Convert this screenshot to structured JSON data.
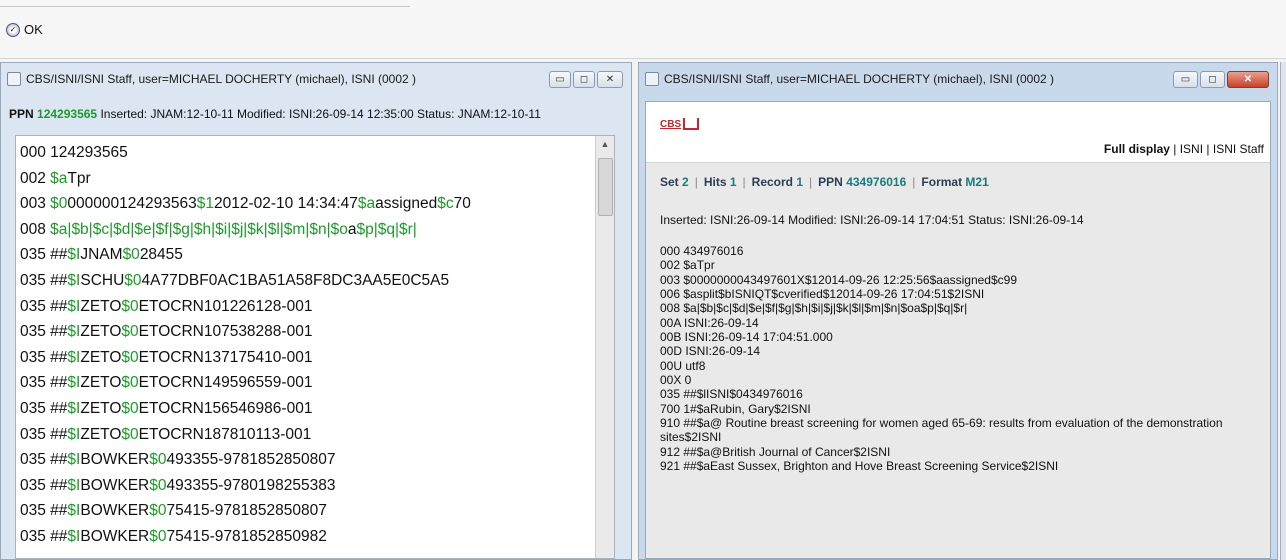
{
  "toolbar": {
    "ok_label": "OK"
  },
  "window_left": {
    "title": "CBS/ISNI/ISNI Staff, user=MICHAEL DOCHERTY (michael), ISNI (0002 )",
    "ppn_label": "PPN",
    "ppn_value": "124293565",
    "ppn_info": " Inserted: JNAM:12-10-11 Modified: ISNI:26-09-14 12:35:00 Status: JNAM:12-10-11",
    "records": [
      [
        {
          "t": "000 124293565",
          "c": "k"
        }
      ],
      [
        {
          "t": "002 ",
          "c": "k"
        },
        {
          "t": "$a",
          "c": "g"
        },
        {
          "t": "Tpr",
          "c": "k"
        }
      ],
      [
        {
          "t": "003 ",
          "c": "k"
        },
        {
          "t": "$0",
          "c": "g"
        },
        {
          "t": "000000124293563",
          "c": "k"
        },
        {
          "t": "$1",
          "c": "g"
        },
        {
          "t": "2012-02-10 14:34:47",
          "c": "k"
        },
        {
          "t": "$a",
          "c": "g"
        },
        {
          "t": "assigned",
          "c": "k"
        },
        {
          "t": "$c",
          "c": "g"
        },
        {
          "t": "70",
          "c": "k"
        }
      ],
      [
        {
          "t": "008 ",
          "c": "k"
        },
        {
          "t": "$a|$b|$c|$d|$e|$f|$g|$h|$i|$j|$k|$l|$m|$n|$o",
          "c": "g"
        },
        {
          "t": "a",
          "c": "k"
        },
        {
          "t": "$p|$q|$r|",
          "c": "g"
        }
      ],
      [
        {
          "t": "035 ##",
          "c": "k"
        },
        {
          "t": "$I",
          "c": "g"
        },
        {
          "t": "JNAM",
          "c": "k"
        },
        {
          "t": "$0",
          "c": "g"
        },
        {
          "t": "28455",
          "c": "k"
        }
      ],
      [
        {
          "t": "035 ##",
          "c": "k"
        },
        {
          "t": "$I",
          "c": "g"
        },
        {
          "t": "SCHU",
          "c": "k"
        },
        {
          "t": "$0",
          "c": "g"
        },
        {
          "t": "4A77DBF0AC1BA51A58F8DC3AA5E0C5A5",
          "c": "k"
        }
      ],
      [
        {
          "t": "035 ##",
          "c": "k"
        },
        {
          "t": "$I",
          "c": "g"
        },
        {
          "t": "ZETO",
          "c": "k"
        },
        {
          "t": "$0",
          "c": "g"
        },
        {
          "t": "ETOCRN101226128-001",
          "c": "k"
        }
      ],
      [
        {
          "t": "035 ##",
          "c": "k"
        },
        {
          "t": "$I",
          "c": "g"
        },
        {
          "t": "ZETO",
          "c": "k"
        },
        {
          "t": "$0",
          "c": "g"
        },
        {
          "t": "ETOCRN107538288-001",
          "c": "k"
        }
      ],
      [
        {
          "t": "035 ##",
          "c": "k"
        },
        {
          "t": "$I",
          "c": "g"
        },
        {
          "t": "ZETO",
          "c": "k"
        },
        {
          "t": "$0",
          "c": "g"
        },
        {
          "t": "ETOCRN137175410-001",
          "c": "k"
        }
      ],
      [
        {
          "t": "035 ##",
          "c": "k"
        },
        {
          "t": "$I",
          "c": "g"
        },
        {
          "t": "ZETO",
          "c": "k"
        },
        {
          "t": "$0",
          "c": "g"
        },
        {
          "t": "ETOCRN149596559-001",
          "c": "k"
        }
      ],
      [
        {
          "t": "035 ##",
          "c": "k"
        },
        {
          "t": "$I",
          "c": "g"
        },
        {
          "t": "ZETO",
          "c": "k"
        },
        {
          "t": "$0",
          "c": "g"
        },
        {
          "t": "ETOCRN156546986-001",
          "c": "k"
        }
      ],
      [
        {
          "t": "035 ##",
          "c": "k"
        },
        {
          "t": "$I",
          "c": "g"
        },
        {
          "t": "ZETO",
          "c": "k"
        },
        {
          "t": "$0",
          "c": "g"
        },
        {
          "t": "ETOCRN187810113-001",
          "c": "k"
        }
      ],
      [
        {
          "t": "035 ##",
          "c": "k"
        },
        {
          "t": "$I",
          "c": "g"
        },
        {
          "t": "BOWKER",
          "c": "k"
        },
        {
          "t": "$0",
          "c": "g"
        },
        {
          "t": "493355-9781852850807",
          "c": "k"
        }
      ],
      [
        {
          "t": "035 ##",
          "c": "k"
        },
        {
          "t": "$I",
          "c": "g"
        },
        {
          "t": "BOWKER",
          "c": "k"
        },
        {
          "t": "$0",
          "c": "g"
        },
        {
          "t": "493355-9780198255383",
          "c": "k"
        }
      ],
      [
        {
          "t": "035 ##",
          "c": "k"
        },
        {
          "t": "$I",
          "c": "g"
        },
        {
          "t": "BOWKER",
          "c": "k"
        },
        {
          "t": "$0",
          "c": "g"
        },
        {
          "t": "75415-9781852850807",
          "c": "k"
        }
      ],
      [
        {
          "t": "035 ##",
          "c": "k"
        },
        {
          "t": "$I",
          "c": "g"
        },
        {
          "t": "BOWKER",
          "c": "k"
        },
        {
          "t": "$0",
          "c": "g"
        },
        {
          "t": "75415-9781852850982",
          "c": "k"
        }
      ]
    ]
  },
  "window_right": {
    "title": "CBS/ISNI/ISNI Staff, user=MICHAEL DOCHERTY (michael), ISNI (0002 )",
    "logo_text": "CBS",
    "links": [
      "Full display",
      "ISNI",
      "ISNI Staff"
    ],
    "set_label": "Set",
    "set_value": "2",
    "hits_label": "Hits",
    "hits_value": "1",
    "record_label": "Record",
    "record_value": "1",
    "ppn_label": "PPN",
    "ppn_value": "434976016",
    "format_label": "Format",
    "format_value": "M21",
    "info": "Inserted: ISNI:26-09-14 Modified: ISNI:26-09-14 17:04:51 Status: ISNI:26-09-14",
    "records": [
      "000 434976016",
      "002 $aTpr",
      "003 $0000000043497601X$12014-09-26 12:25:56$aassigned$c99",
      "006 $asplit$bISNIQT$cverified$12014-09-26 17:04:51$2ISNI",
      "008 $a|$b|$c|$d|$e|$f|$g|$h|$i|$j|$k|$l|$m|$n|$oa$p|$q|$r|",
      "00A ISNI:26-09-14",
      "00B ISNI:26-09-14 17:04:51.000",
      "00D ISNI:26-09-14",
      "00U utf8",
      "00X 0",
      "035 ##$lISNI$0434976016",
      "700 1#$aRubin, Gary$2ISNI",
      "910 ##$a@ Routine breast screening for women aged 65-69: results from evaluation of the demonstration sites$2ISNI",
      "912 ##$a@British Journal of Cancer$2ISNI",
      "921 ##$aEast Sussex, Brighton and Hove Breast Screening Service$2ISNI"
    ]
  },
  "colors": {
    "subfield_green": "#1e9a2a",
    "link_teal": "#1a7a82"
  }
}
